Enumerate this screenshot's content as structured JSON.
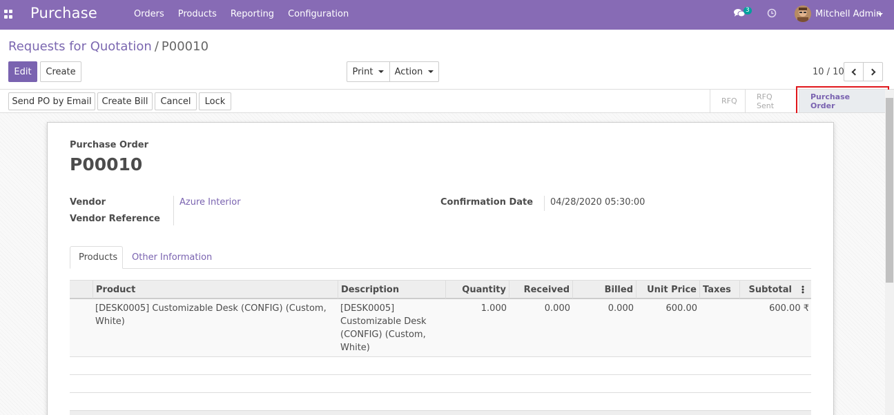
{
  "navbar": {
    "app_name": "Purchase",
    "menu": [
      "Orders",
      "Products",
      "Reporting",
      "Configuration"
    ],
    "chat_badge": "3",
    "user_name": "Mitchell Admin"
  },
  "breadcrumb": {
    "parent": "Requests for Quotation",
    "separator": "/",
    "current": "P00010"
  },
  "toolbar": {
    "edit_label": "Edit",
    "create_label": "Create",
    "print_label": "Print",
    "action_label": "Action",
    "pager": "10 / 10"
  },
  "status_actions": {
    "send_po_label": "Send PO by Email",
    "create_bill_label": "Create Bill",
    "cancel_label": "Cancel",
    "lock_label": "Lock"
  },
  "stages": [
    "RFQ",
    "RFQ Sent",
    "Purchase Order"
  ],
  "active_stage": "Purchase Order",
  "form": {
    "doc_type": "Purchase Order",
    "name": "P00010",
    "vendor_label": "Vendor",
    "vendor_value": "Azure Interior",
    "vendor_ref_label": "Vendor Reference",
    "vendor_ref_value": "",
    "confirmation_date_label": "Confirmation Date",
    "confirmation_date_value": "04/28/2020 05:30:00"
  },
  "tabs": [
    "Products",
    "Other Information"
  ],
  "lines_table": {
    "columns": [
      "Product",
      "Description",
      "Quantity",
      "Received",
      "Billed",
      "Unit Price",
      "Taxes",
      "Subtotal"
    ],
    "rows": [
      {
        "product": "[DESK0005] Customizable Desk (CONFIG) (Custom, White)",
        "description_lines": [
          "[DESK0005]",
          "Customizable Desk",
          "(CONFIG) (Custom,",
          "White)"
        ],
        "quantity": "1.000",
        "received": "0.000",
        "billed": "0.000",
        "unit_price": "600.00",
        "taxes": "",
        "subtotal": "600.00 ₹"
      }
    ]
  },
  "colors": {
    "navbar": "#876bb5",
    "primary": "#7a63b0",
    "highlight": "#e0151a"
  }
}
